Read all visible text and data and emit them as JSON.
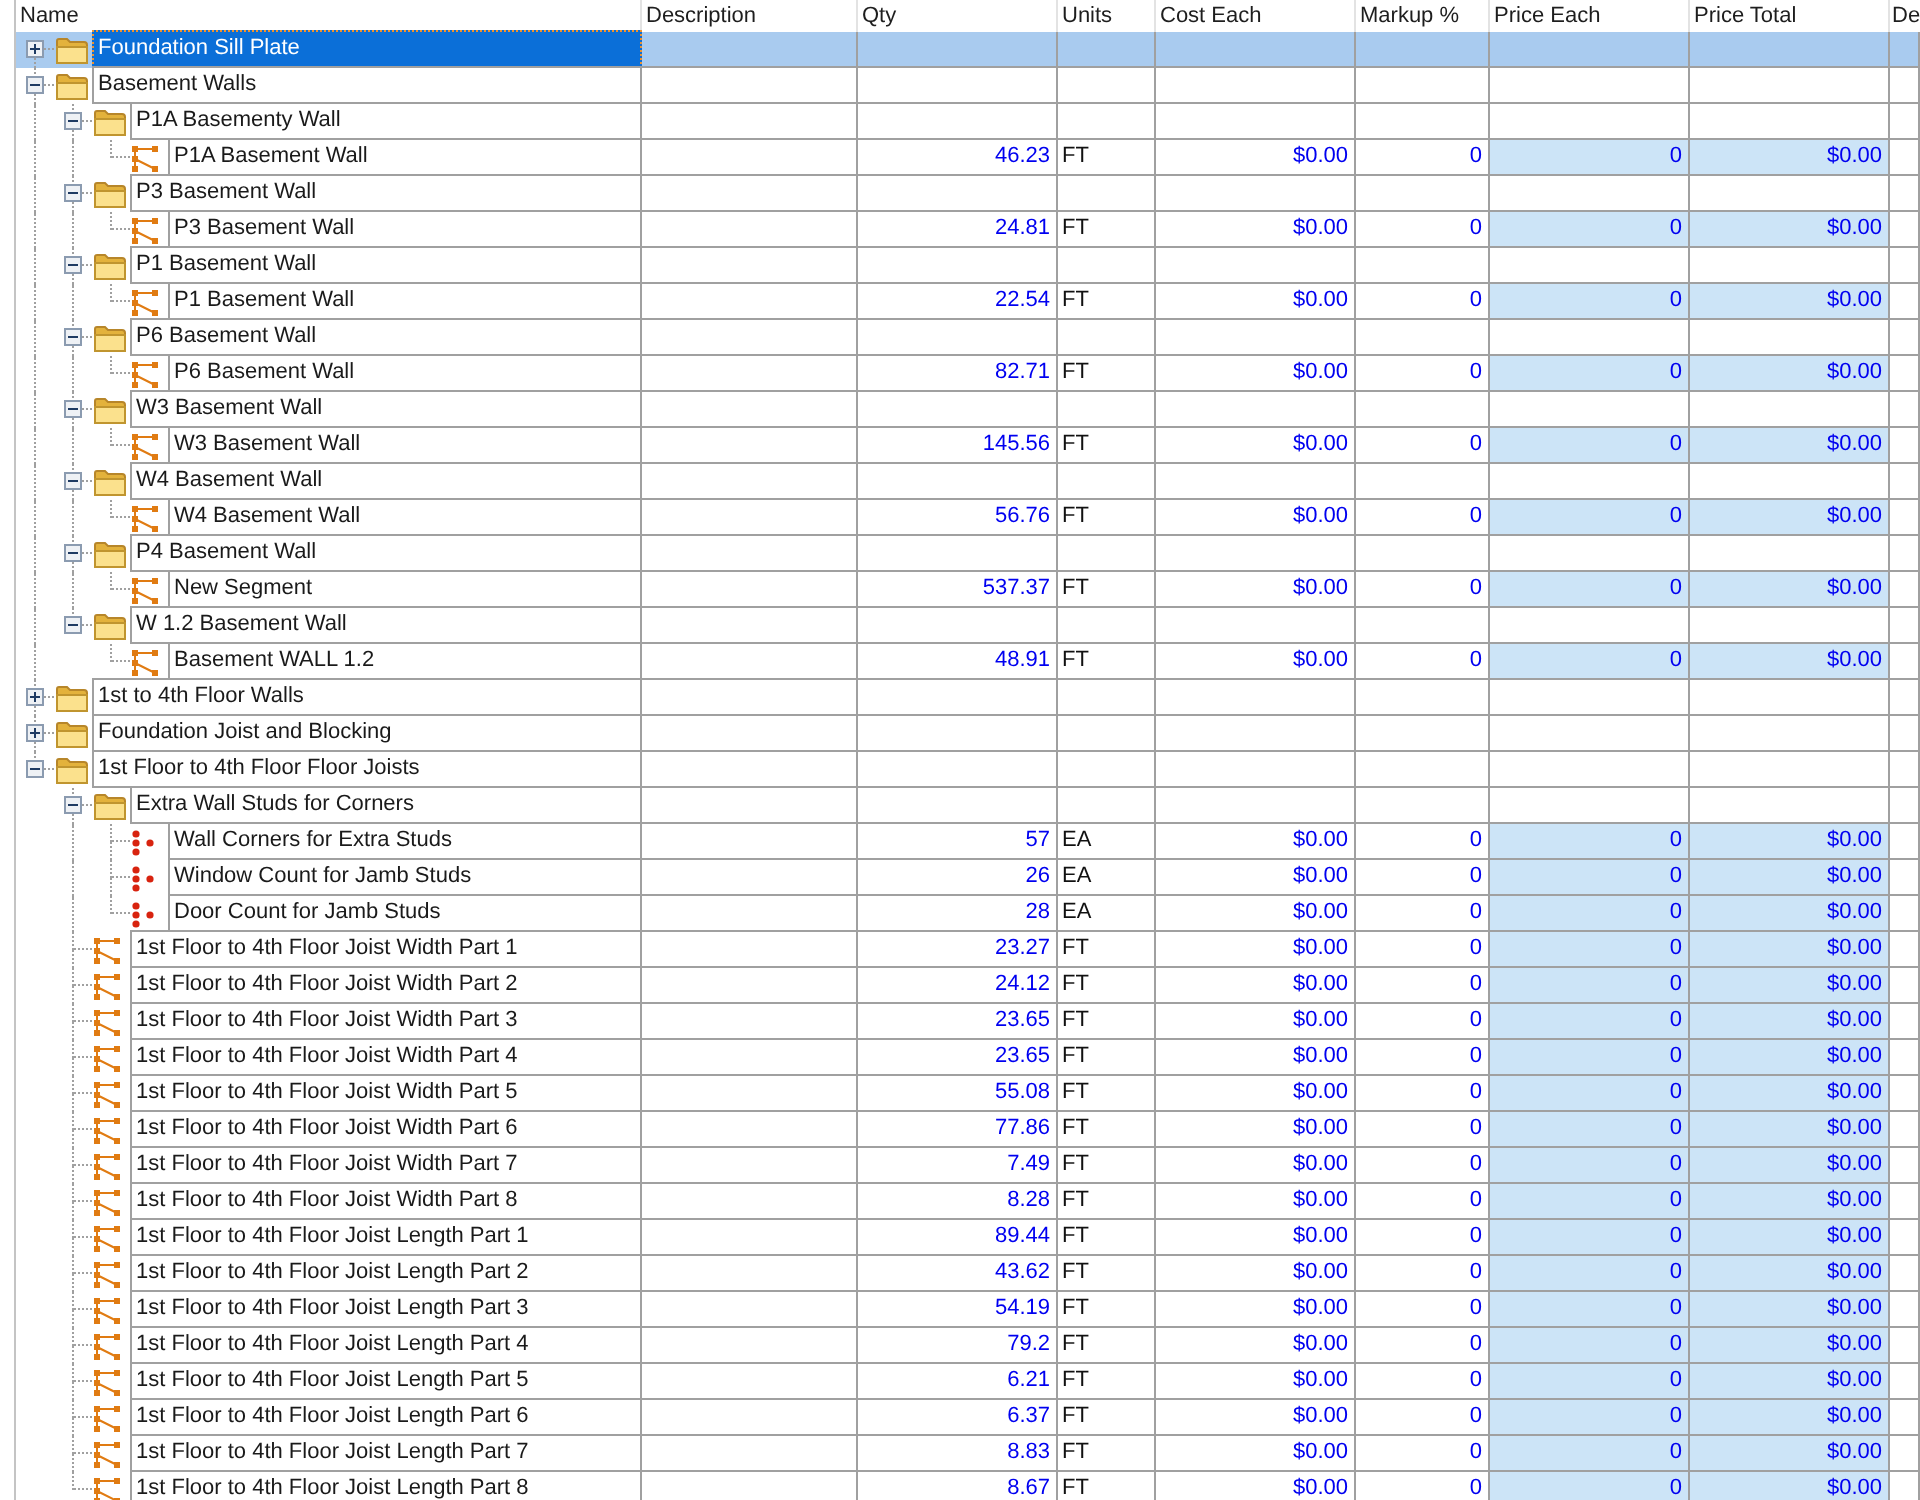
{
  "table": {
    "columns": [
      "Name",
      "Description",
      "Qty",
      "Units",
      "Cost Each",
      "Markup %",
      "Price Each",
      "Price Total",
      "De"
    ],
    "rows": [
      {
        "kind": "folder",
        "name": "Foundation Sill Plate",
        "selected": true,
        "expanded": false
      },
      {
        "kind": "folder",
        "name": "Basement Walls",
        "selected": false,
        "expanded": true,
        "children": [
          {
            "kind": "folder",
            "name": "P1A Basementy Wall",
            "selected": false,
            "expanded": true,
            "children": [
              {
                "kind": "linear",
                "name": "P1A Basement Wall",
                "selected": false,
                "qty": "46.23",
                "units": "FT",
                "cost_each": "$0.00",
                "markup": "0",
                "price_each": "0",
                "price_total": "$0.00"
              }
            ]
          },
          {
            "kind": "folder",
            "name": "P3 Basement Wall",
            "selected": false,
            "expanded": true,
            "children": [
              {
                "kind": "linear",
                "name": "P3 Basement Wall",
                "selected": false,
                "qty": "24.81",
                "units": "FT",
                "cost_each": "$0.00",
                "markup": "0",
                "price_each": "0",
                "price_total": "$0.00"
              }
            ]
          },
          {
            "kind": "folder",
            "name": "P1 Basement Wall",
            "selected": false,
            "expanded": true,
            "children": [
              {
                "kind": "linear",
                "name": "P1 Basement Wall",
                "selected": false,
                "qty": "22.54",
                "units": "FT",
                "cost_each": "$0.00",
                "markup": "0",
                "price_each": "0",
                "price_total": "$0.00"
              }
            ]
          },
          {
            "kind": "folder",
            "name": "P6 Basement Wall",
            "selected": false,
            "expanded": true,
            "children": [
              {
                "kind": "linear",
                "name": "P6 Basement Wall",
                "selected": false,
                "qty": "82.71",
                "units": "FT",
                "cost_each": "$0.00",
                "markup": "0",
                "price_each": "0",
                "price_total": "$0.00"
              }
            ]
          },
          {
            "kind": "folder",
            "name": "W3 Basement Wall",
            "selected": false,
            "expanded": true,
            "children": [
              {
                "kind": "linear",
                "name": "W3 Basement Wall",
                "selected": false,
                "qty": "145.56",
                "units": "FT",
                "cost_each": "$0.00",
                "markup": "0",
                "price_each": "0",
                "price_total": "$0.00"
              }
            ]
          },
          {
            "kind": "folder",
            "name": "W4 Basement Wall",
            "selected": false,
            "expanded": true,
            "children": [
              {
                "kind": "linear",
                "name": "W4 Basement Wall",
                "selected": false,
                "qty": "56.76",
                "units": "FT",
                "cost_each": "$0.00",
                "markup": "0",
                "price_each": "0",
                "price_total": "$0.00"
              }
            ]
          },
          {
            "kind": "folder",
            "name": "P4 Basement Wall",
            "selected": false,
            "expanded": true,
            "children": [
              {
                "kind": "linear",
                "name": "New Segment",
                "selected": false,
                "qty": "537.37",
                "units": "FT",
                "cost_each": "$0.00",
                "markup": "0",
                "price_each": "0",
                "price_total": "$0.00"
              }
            ]
          },
          {
            "kind": "folder",
            "name": "W 1.2 Basement Wall",
            "selected": false,
            "expanded": true,
            "children": [
              {
                "kind": "linear",
                "name": "Basement WALL 1.2",
                "selected": false,
                "qty": "48.91",
                "units": "FT",
                "cost_each": "$0.00",
                "markup": "0",
                "price_each": "0",
                "price_total": "$0.00"
              }
            ]
          }
        ]
      },
      {
        "kind": "folder",
        "name": "1st to 4th Floor Walls",
        "selected": false,
        "expanded": false
      },
      {
        "kind": "folder",
        "name": "Foundation Joist and Blocking",
        "selected": false,
        "expanded": false
      },
      {
        "kind": "folder",
        "name": "1st Floor to 4th Floor Floor Joists",
        "selected": false,
        "expanded": true,
        "children": [
          {
            "kind": "folder",
            "name": "Extra Wall Studs for Corners",
            "selected": false,
            "expanded": true,
            "children": [
              {
                "kind": "count",
                "name": "Wall Corners for Extra Studs",
                "selected": false,
                "qty": "57",
                "units": "EA",
                "cost_each": "$0.00",
                "markup": "0",
                "price_each": "0",
                "price_total": "$0.00"
              },
              {
                "kind": "count",
                "name": "Window Count for Jamb Studs",
                "selected": false,
                "qty": "26",
                "units": "EA",
                "cost_each": "$0.00",
                "markup": "0",
                "price_each": "0",
                "price_total": "$0.00"
              },
              {
                "kind": "count",
                "name": "Door Count for Jamb Studs",
                "selected": false,
                "qty": "28",
                "units": "EA",
                "cost_each": "$0.00",
                "markup": "0",
                "price_each": "0",
                "price_total": "$0.00"
              }
            ]
          },
          {
            "kind": "linear",
            "name": "1st Floor to 4th Floor Joist Width Part 1",
            "selected": false,
            "qty": "23.27",
            "units": "FT",
            "cost_each": "$0.00",
            "markup": "0",
            "price_each": "0",
            "price_total": "$0.00"
          },
          {
            "kind": "linear",
            "name": "1st Floor to 4th Floor Joist Width Part 2",
            "selected": false,
            "qty": "24.12",
            "units": "FT",
            "cost_each": "$0.00",
            "markup": "0",
            "price_each": "0",
            "price_total": "$0.00"
          },
          {
            "kind": "linear",
            "name": "1st Floor to 4th Floor Joist Width Part 3",
            "selected": false,
            "qty": "23.65",
            "units": "FT",
            "cost_each": "$0.00",
            "markup": "0",
            "price_each": "0",
            "price_total": "$0.00"
          },
          {
            "kind": "linear",
            "name": "1st Floor to 4th Floor Joist Width Part 4",
            "selected": false,
            "qty": "23.65",
            "units": "FT",
            "cost_each": "$0.00",
            "markup": "0",
            "price_each": "0",
            "price_total": "$0.00"
          },
          {
            "kind": "linear",
            "name": "1st Floor to 4th Floor Joist Width Part 5",
            "selected": false,
            "qty": "55.08",
            "units": "FT",
            "cost_each": "$0.00",
            "markup": "0",
            "price_each": "0",
            "price_total": "$0.00"
          },
          {
            "kind": "linear",
            "name": "1st Floor to 4th Floor Joist Width Part 6",
            "selected": false,
            "qty": "77.86",
            "units": "FT",
            "cost_each": "$0.00",
            "markup": "0",
            "price_each": "0",
            "price_total": "$0.00"
          },
          {
            "kind": "linear",
            "name": "1st Floor to 4th Floor Joist Width Part 7",
            "selected": false,
            "qty": "7.49",
            "units": "FT",
            "cost_each": "$0.00",
            "markup": "0",
            "price_each": "0",
            "price_total": "$0.00"
          },
          {
            "kind": "linear",
            "name": "1st Floor to 4th Floor Joist Width Part 8",
            "selected": false,
            "qty": "8.28",
            "units": "FT",
            "cost_each": "$0.00",
            "markup": "0",
            "price_each": "0",
            "price_total": "$0.00"
          },
          {
            "kind": "linear",
            "name": "1st Floor to 4th Floor Joist Length Part 1",
            "selected": false,
            "qty": "89.44",
            "units": "FT",
            "cost_each": "$0.00",
            "markup": "0",
            "price_each": "0",
            "price_total": "$0.00"
          },
          {
            "kind": "linear",
            "name": "1st Floor to 4th Floor Joist Length Part 2",
            "selected": false,
            "qty": "43.62",
            "units": "FT",
            "cost_each": "$0.00",
            "markup": "0",
            "price_each": "0",
            "price_total": "$0.00"
          },
          {
            "kind": "linear",
            "name": "1st Floor to 4th Floor Joist Length Part 3",
            "selected": false,
            "qty": "54.19",
            "units": "FT",
            "cost_each": "$0.00",
            "markup": "0",
            "price_each": "0",
            "price_total": "$0.00"
          },
          {
            "kind": "linear",
            "name": "1st Floor to 4th Floor Joist Length Part 4",
            "selected": false,
            "qty": "79.2",
            "units": "FT",
            "cost_each": "$0.00",
            "markup": "0",
            "price_each": "0",
            "price_total": "$0.00"
          },
          {
            "kind": "linear",
            "name": "1st Floor to 4th Floor Joist Length Part 5",
            "selected": false,
            "qty": "6.21",
            "units": "FT",
            "cost_each": "$0.00",
            "markup": "0",
            "price_each": "0",
            "price_total": "$0.00"
          },
          {
            "kind": "linear",
            "name": "1st Floor to 4th Floor Joist Length Part 6",
            "selected": false,
            "qty": "6.37",
            "units": "FT",
            "cost_each": "$0.00",
            "markup": "0",
            "price_each": "0",
            "price_total": "$0.00"
          },
          {
            "kind": "linear",
            "name": "1st Floor to 4th Floor Joist Length Part 7",
            "selected": false,
            "qty": "8.83",
            "units": "FT",
            "cost_each": "$0.00",
            "markup": "0",
            "price_each": "0",
            "price_total": "$0.00"
          },
          {
            "kind": "linear",
            "name": "1st Floor to 4th Floor Joist Length Part 8",
            "selected": false,
            "qty": "8.67",
            "units": "FT",
            "cost_each": "$0.00",
            "markup": "0",
            "price_each": "0",
            "price_total": "$0.00"
          }
        ]
      }
    ]
  }
}
